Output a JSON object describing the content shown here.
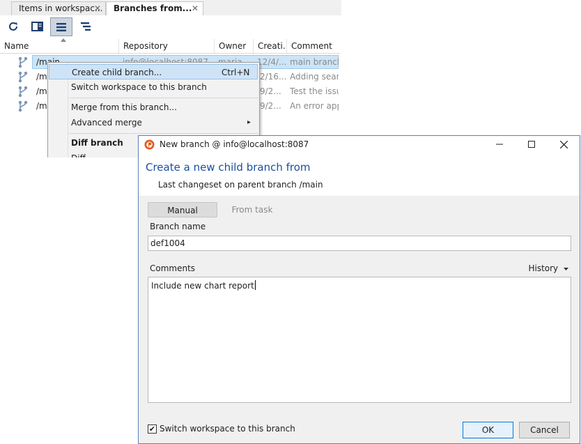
{
  "tabs": [
    {
      "label": "Items in workspac...",
      "close": "✕",
      "active": false
    },
    {
      "label": "Branches from...",
      "close": "✕",
      "active": true
    }
  ],
  "toolbar": {
    "icons": [
      "refresh-icon",
      "panel-icon",
      "list-view-icon",
      "tree-view-icon"
    ]
  },
  "columns": [
    "Name",
    "Repository",
    "Owner",
    "Creati...",
    "Comment"
  ],
  "rows": [
    {
      "name": "/main",
      "repository": "info@localhost:8087",
      "owner": "maria",
      "created": "12/4/...",
      "comment": "main branch"
    },
    {
      "name": "/m",
      "repository": "",
      "owner": "",
      "created": "2/16...",
      "comment": "Adding searc"
    },
    {
      "name": "/m",
      "repository": "",
      "owner": "",
      "created": "9/2...",
      "comment": "Test the issue"
    },
    {
      "name": "/m",
      "repository": "",
      "owner": "",
      "created": "9/2...",
      "comment": "An error appe"
    }
  ],
  "context_menu": {
    "create_child": {
      "label": "Create child branch...",
      "shortcut": "Ctrl+N"
    },
    "switch_workspace": "Switch workspace to this branch",
    "merge_from": "Merge from this branch...",
    "advanced_merge": "Advanced merge",
    "advanced_arrow": "▸",
    "diff_branch": "Diff branch",
    "diff": "Diff"
  },
  "dialog": {
    "title": "New branch @ info@localhost:8087",
    "heading": "Create a new child branch from",
    "subheading": "Last changeset on parent branch /main",
    "mode_manual": "Manual",
    "mode_task": "From task",
    "branch_name_label": "Branch name",
    "branch_name_value": "def1004",
    "comments_label": "Comments",
    "history_label": "History",
    "comments_value": "Include new chart report",
    "switch_checkbox_label": "Switch workspace to this branch",
    "switch_checked": "✔",
    "ok": "OK",
    "cancel": "Cancel"
  },
  "colors": {
    "accent": "#1a4f9c",
    "selection": "#cce4f7",
    "dialog_border": "#5a7fb8"
  }
}
